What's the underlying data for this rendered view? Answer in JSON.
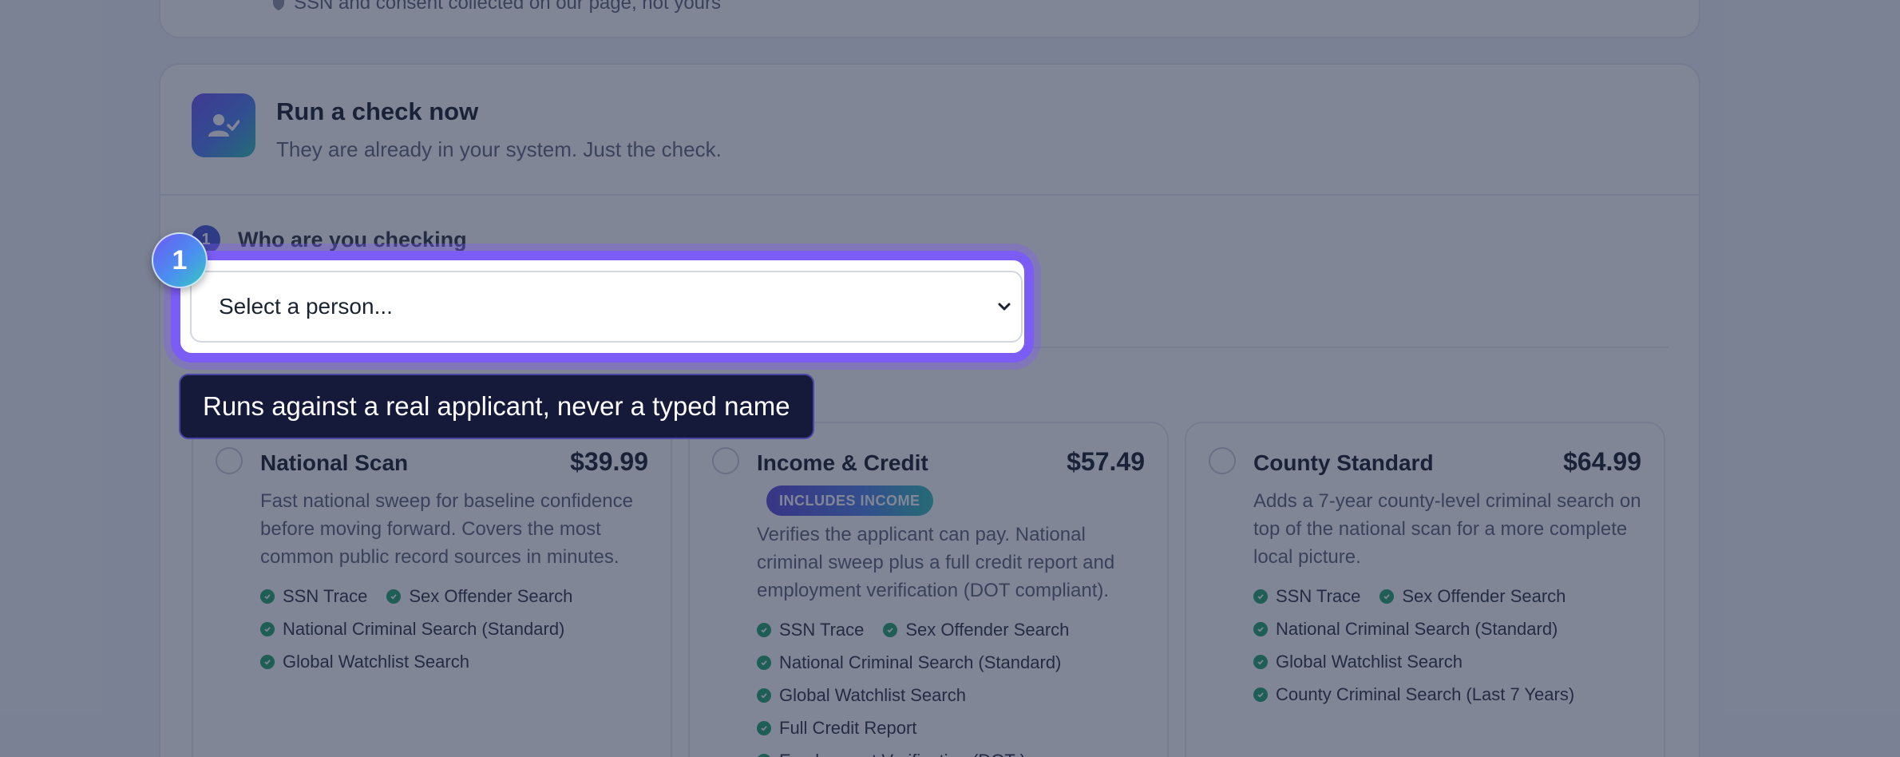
{
  "previous_card": {
    "note": "SSN and consent collected on our page, not yours"
  },
  "card": {
    "title": "Run a check now",
    "subtitle": "They are already in your system. Just the check.",
    "step": {
      "number": "1",
      "label": "Who are you checking"
    },
    "select": {
      "value": "Select a person..."
    }
  },
  "tour": {
    "badge": "1",
    "tooltip": "Runs against a real applicant, never a typed name",
    "accent_color": "#7b5cf4"
  },
  "plans": [
    {
      "name": "National Scan",
      "price": "$39.99",
      "badge": "",
      "description": "Fast national sweep for baseline confidence before moving forward. Covers the most common public record sources in minutes.",
      "features": [
        "SSN Trace",
        "Sex Offender Search",
        "National Criminal Search (Standard)",
        "Global Watchlist Search"
      ]
    },
    {
      "name": "Income & Credit",
      "price": "$57.49",
      "badge": "INCLUDES INCOME",
      "description": "Verifies the applicant can pay. National criminal sweep plus a full credit report and employment verification (DOT compliant).",
      "features": [
        "SSN Trace",
        "Sex Offender Search",
        "National Criminal Search (Standard)",
        "Global Watchlist Search",
        "Full Credit Report",
        "Employment Verification (DOT )"
      ]
    },
    {
      "name": "County Standard",
      "price": "$64.99",
      "badge": "",
      "description": "Adds a 7-year county-level criminal search on top of the national scan for a more complete local picture.",
      "features": [
        "SSN Trace",
        "Sex Offender Search",
        "National Criminal Search (Standard)",
        "Global Watchlist Search",
        "County Criminal Search (Last 7 Years)"
      ]
    }
  ],
  "colors": {
    "check": "#1fa46a",
    "overlay": "rgba(30,40,70,0.56)"
  }
}
